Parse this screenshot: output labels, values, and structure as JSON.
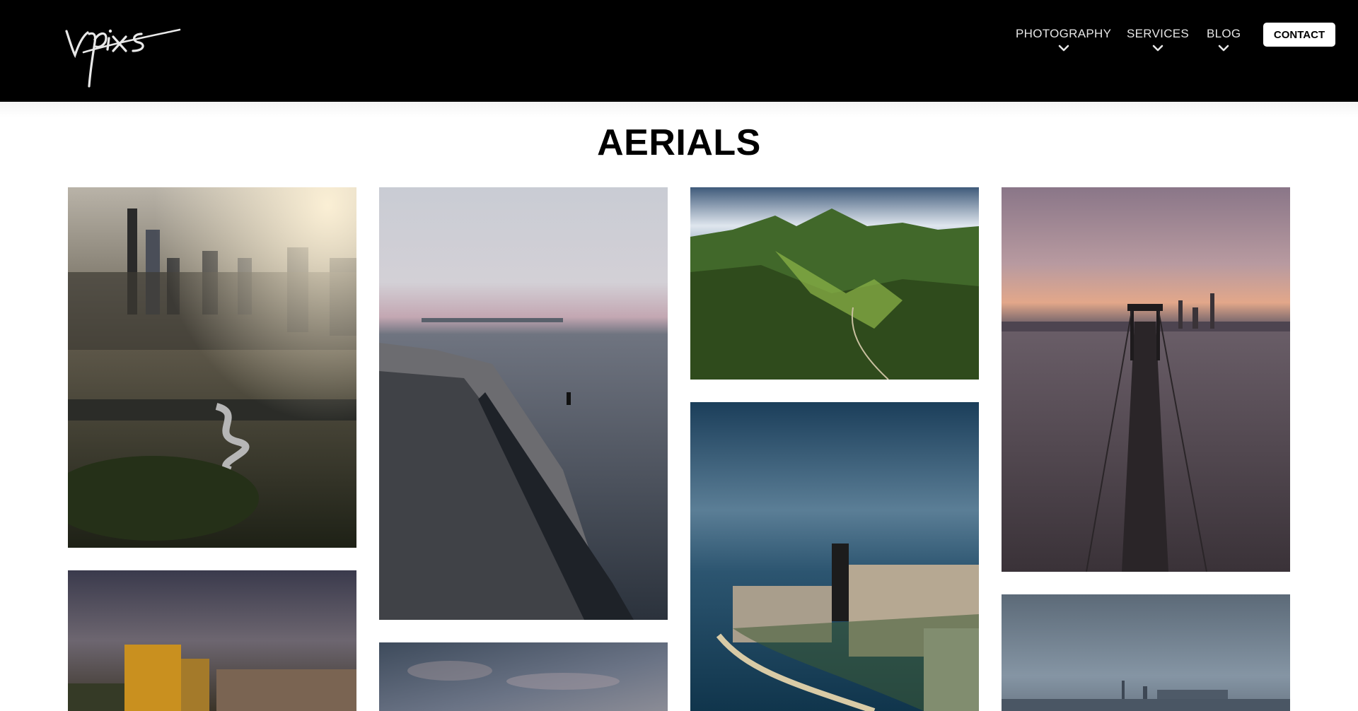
{
  "brand": {
    "logo_text": "vnpixs"
  },
  "nav": {
    "items": [
      {
        "label": "PHOTOGRAPHY"
      },
      {
        "label": "SERVICES"
      },
      {
        "label": "BLOG"
      }
    ],
    "contact_label": "CONTACT"
  },
  "page": {
    "title": "AERIALS"
  },
  "gallery": {
    "photos": [
      {
        "subject": "chicago-park-aerial-sunrise"
      },
      {
        "subject": "lakefront-breakwater-person"
      },
      {
        "subject": "green-mountains-valley"
      },
      {
        "subject": "bay-bridge-aerial-sunset"
      },
      {
        "subject": "city-skyline-golden-light"
      },
      {
        "subject": "chicago-lakefront-aerial"
      },
      {
        "subject": "cloudy-sky-aerial"
      },
      {
        "subject": "distant-skyline-overcast"
      }
    ]
  },
  "icons": {
    "chevron": "chevron-down-icon"
  },
  "colors": {
    "header_bg": "#000000",
    "nav_text": "#e6e6e6",
    "contact_bg": "#ffffff"
  }
}
